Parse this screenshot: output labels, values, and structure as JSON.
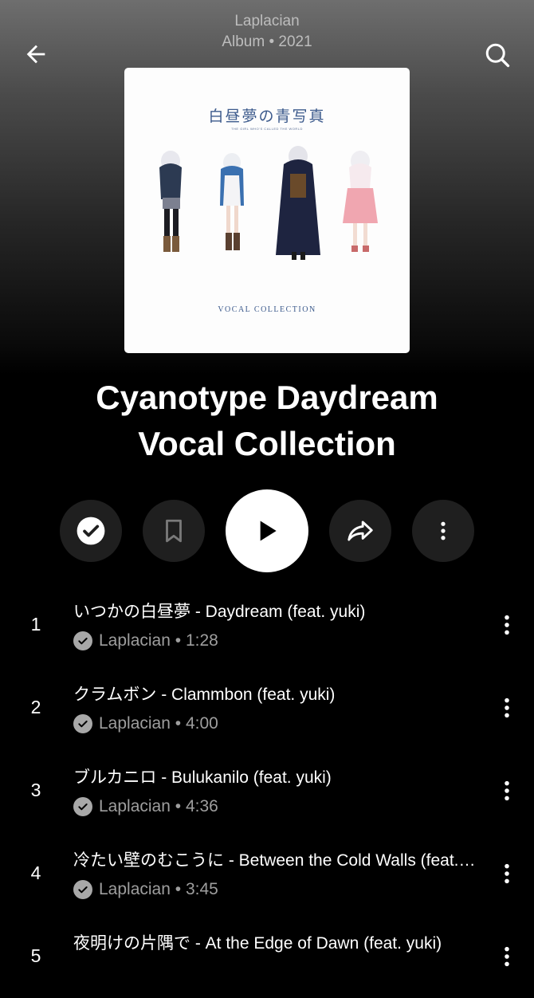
{
  "header": {
    "artist": "Laplacian",
    "subtitle": "Album • 2021"
  },
  "icons": {
    "back": "arrow-back-icon",
    "search": "search-icon",
    "library": "check-icon",
    "save": "bookmark-icon",
    "play": "play-icon",
    "share": "share-icon",
    "more": "more-vert-icon"
  },
  "cover": {
    "title_jp": "白昼夢の青写真",
    "subtitle_en": "THE GIRL WHO'S CALLED THE WORLD",
    "footer": "VOCAL COLLECTION"
  },
  "album": {
    "title": "Cyanotype Daydream\nVocal Collection"
  },
  "tracks": [
    {
      "number": "1",
      "title": "いつかの白昼夢 - Daydream (feat. yuki)",
      "artist": "Laplacian",
      "duration": "1:28"
    },
    {
      "number": "2",
      "title": "クラムボン - Clammbon (feat. yuki)",
      "artist": "Laplacian",
      "duration": "4:00"
    },
    {
      "number": "3",
      "title": "ブルカニロ - Bulukanilo (feat. yuki)",
      "artist": "Laplacian",
      "duration": "4:36"
    },
    {
      "number": "4",
      "title": "冷たい壁のむこうに - Between the Cold Walls (feat. yuki)",
      "artist": "Laplacian",
      "duration": "3:45"
    },
    {
      "number": "5",
      "title": "夜明けの片隅で - At the Edge of Dawn (feat. yuki)",
      "artist": "",
      "duration": ""
    }
  ],
  "colors": {
    "background": "#000000",
    "button_bg": "#1f1f1f",
    "secondary_text": "#9e9e9e",
    "cover_accent": "#3c5a8c"
  }
}
